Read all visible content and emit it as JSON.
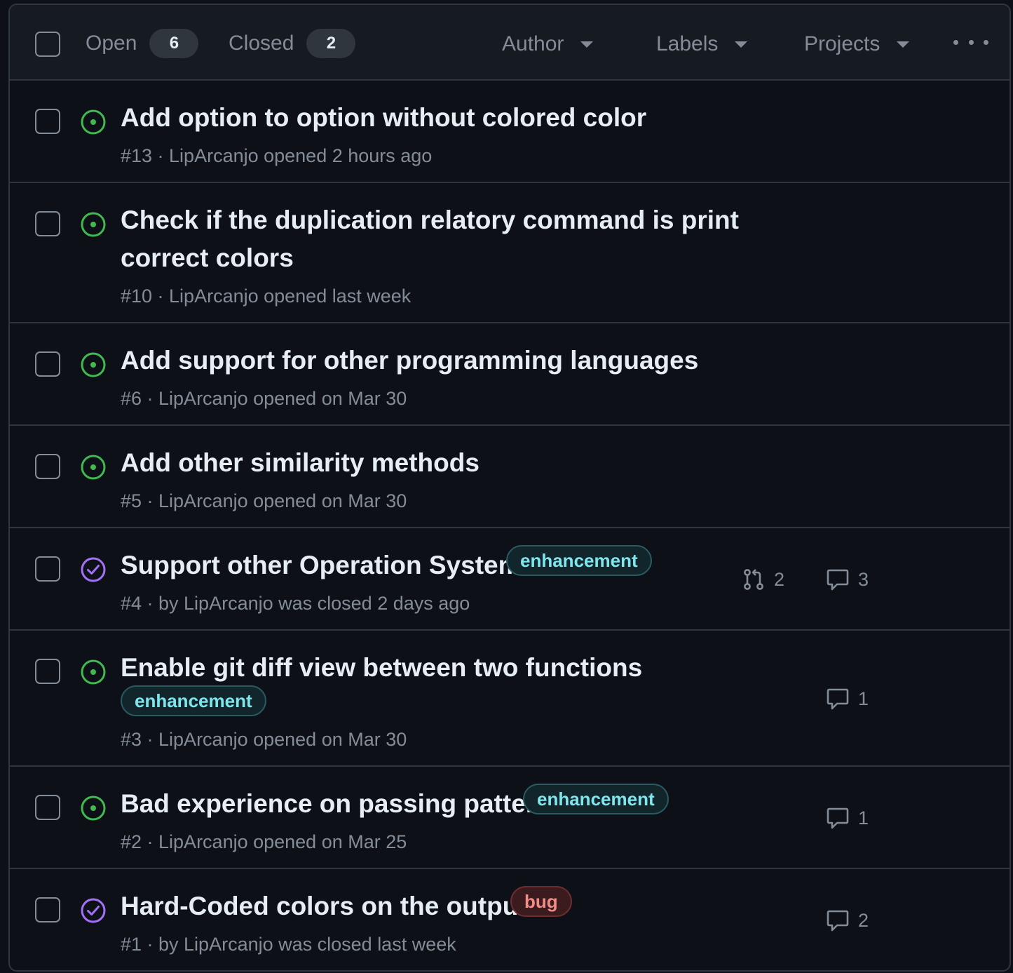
{
  "filters": {
    "open_label": "Open",
    "open_count": "6",
    "closed_label": "Closed",
    "closed_count": "2",
    "author": "Author",
    "labels": "Labels",
    "projects": "Projects"
  },
  "issues": [
    {
      "title": "Add option to option without colored color",
      "meta": "#13 · LipArcanjo opened 2 hours ago",
      "state": "open"
    },
    {
      "title_line1": "Check if the duplication relatory command is print",
      "title_line2": "correct colors",
      "meta": "#10 · LipArcanjo opened last week",
      "state": "open"
    },
    {
      "title": "Add support for other programming languages",
      "meta": "#6 · LipArcanjo opened on Mar 30",
      "state": "open"
    },
    {
      "title": "Add other similarity methods",
      "meta": "#5 · LipArcanjo opened on Mar 30",
      "state": "open"
    },
    {
      "title": "Support other Operation System.",
      "label": "enhancement",
      "meta": "#4 · by LipArcanjo was closed 2 days ago",
      "state": "closed",
      "pull_requests": "2",
      "comments": "3"
    },
    {
      "title": "Enable git diff view between two functions",
      "label": "enhancement",
      "meta": "#3 · LipArcanjo opened on Mar 30",
      "state": "open",
      "comments": "1"
    },
    {
      "title": "Bad experience on passing pattern",
      "label": "enhancement",
      "meta": "#2 · LipArcanjo opened on Mar 25",
      "state": "open",
      "comments": "1"
    },
    {
      "title": "Hard-Coded colors on the output",
      "label": "bug",
      "meta": "#1 · by LipArcanjo was closed last week",
      "state": "closed",
      "comments": "2"
    }
  ],
  "colors": {
    "open": "#3fb950",
    "closed": "#a371f7",
    "enhancement_text": "#7ee6ed",
    "bug_text": "#f28c87"
  }
}
